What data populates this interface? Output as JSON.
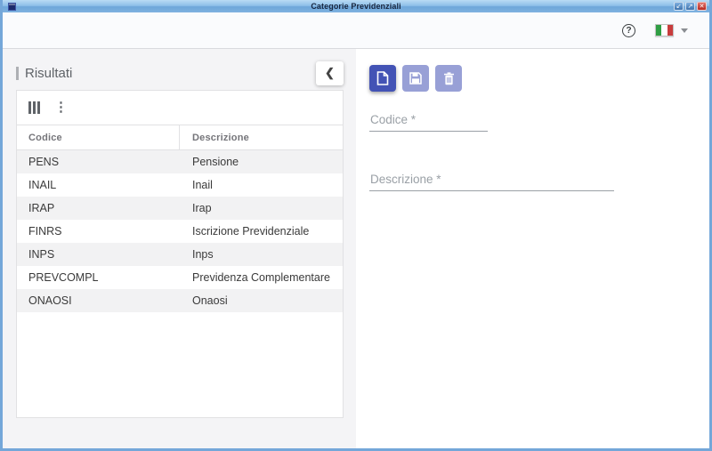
{
  "window": {
    "title": "Categorie Previdenziali",
    "controls": {
      "restore": "↙",
      "maximize": "↗",
      "close": "✕"
    }
  },
  "toolbar": {
    "help_glyph": "?",
    "language": {
      "name": "italian-flag",
      "colors": [
        "#2f9e44",
        "#ffffff",
        "#c83c3c"
      ]
    }
  },
  "results_panel": {
    "title": "Risultati",
    "collapse_glyph": "❮",
    "kebab_glyph": "⋮",
    "table": {
      "columns": [
        "Codice",
        "Descrizione"
      ],
      "rows": [
        {
          "codice": "PENS",
          "descrizione": "Pensione"
        },
        {
          "codice": "INAIL",
          "descrizione": "Inail"
        },
        {
          "codice": "IRAP",
          "descrizione": "Irap"
        },
        {
          "codice": "FINRS",
          "descrizione": "Iscrizione Previdenziale"
        },
        {
          "codice": "INPS",
          "descrizione": "Inps"
        },
        {
          "codice": "PREVCOMPL",
          "descrizione": "Previdenza Complementare"
        },
        {
          "codice": "ONAOSI",
          "descrizione": "Onaosi"
        }
      ]
    }
  },
  "detail_panel": {
    "buttons": [
      {
        "name": "new",
        "enabled": true
      },
      {
        "name": "save",
        "enabled": false
      },
      {
        "name": "delete",
        "enabled": false
      }
    ],
    "fields": [
      {
        "name": "codice",
        "label": "Codice *",
        "value": ""
      },
      {
        "name": "descrizione",
        "label": "Descrizione *",
        "value": ""
      }
    ]
  },
  "colors": {
    "accent": "#4353b5",
    "accent_disabled": "#98a0d6",
    "titlebar": "#7fb2e0",
    "window_border": "#74a7d9",
    "panel_bg": "#f4f4f6",
    "zebra": "#f2f2f3"
  }
}
